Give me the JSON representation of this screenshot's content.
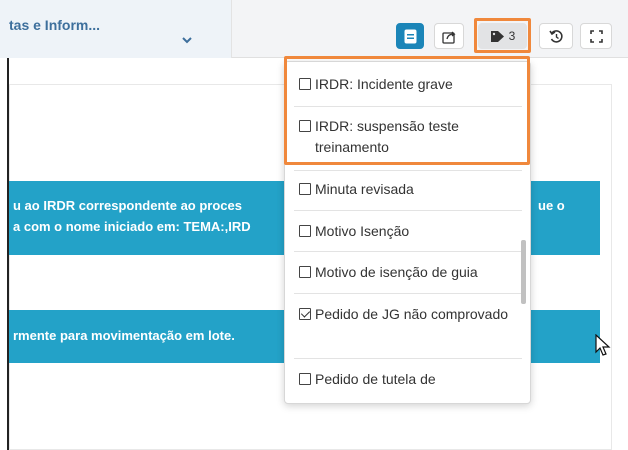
{
  "header": {
    "breadcrumb_text": "tas e Inform...",
    "tags_count": "3"
  },
  "banners": {
    "first_line1": "u ao IRDR correspondente ao proces",
    "first_line1_right": "ue o",
    "first_line2": "a com o nome iniciado em: TEMA:,IRD",
    "second_line1": "rmente para movimentação em lote."
  },
  "tags_dropdown": {
    "items": [
      {
        "label": "IRDR: Incidente grave",
        "checked": false
      },
      {
        "label": "IRDR: suspensão teste treinamento",
        "checked": false
      },
      {
        "label": "Minuta revisada",
        "checked": false
      },
      {
        "label": "Motivo Isenção",
        "checked": false
      },
      {
        "label": "Motivo de isenção de guia",
        "checked": false
      },
      {
        "label": "Pedido de JG não comprovado",
        "checked": true
      },
      {
        "label": "Pedido de tutela de",
        "checked": false
      }
    ]
  },
  "colors": {
    "accent": "#1b85b8",
    "banner": "#23a2c8",
    "highlight": "#f0883c"
  }
}
